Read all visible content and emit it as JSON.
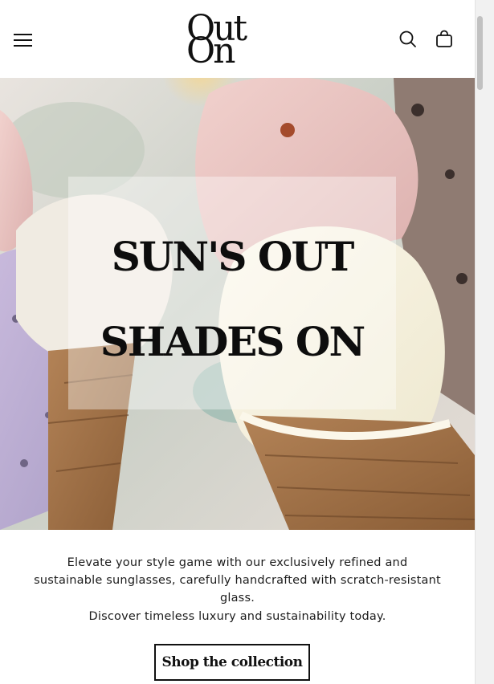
{
  "header": {
    "logo_line1": "Out",
    "logo_line2": "On",
    "menu_icon": "hamburger-menu-icon",
    "search_icon": "search-icon",
    "bag_icon": "shopping-bag-icon"
  },
  "hero": {
    "title_line1": "SUN'S OUT",
    "title_line2": "SHADES ON",
    "image": "ice-cream-cones-photo"
  },
  "content": {
    "description": "Elevate your style game with our exclusively refined and sustainable sunglasses, carefully handcrafted with scratch-resistant glass.",
    "tagline": "Discover timeless luxury and sustainability today.",
    "cta_label": "Shop the collection"
  },
  "colors": {
    "text": "#111111",
    "background": "#ffffff",
    "cta_border": "#111111"
  }
}
